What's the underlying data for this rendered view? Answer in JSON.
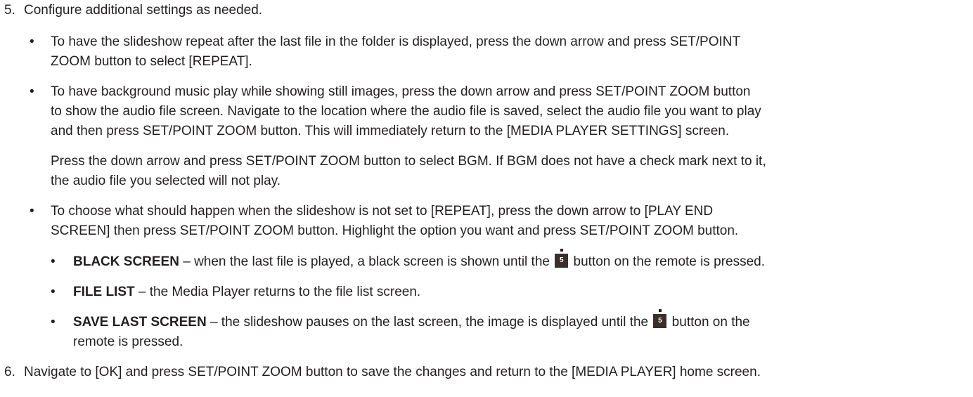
{
  "step5": {
    "number": "5.",
    "text": "Configure additional settings as needed."
  },
  "bullet_repeat": {
    "marker": "•",
    "line1": "To have the slideshow repeat after the last file in the folder is displayed, press the down arrow and press SET/POINT",
    "line2": "ZOOM button to select [REPEAT]."
  },
  "bullet_bgm": {
    "marker": "•",
    "line1": "To have background music play while showing still images, press the down arrow and press SET/POINT ZOOM button",
    "line2": "to show the audio file screen. Navigate to the location where the audio file is saved, select the audio file you want to play",
    "line3": "and then press SET/POINT ZOOM button. This will immediately return to the [MEDIA PLAYER SETTINGS] screen."
  },
  "bgm_note": {
    "line1": "Press the down arrow and press SET/POINT ZOOM button to select BGM. If BGM does not have a check mark next to it,",
    "line2": "the audio file you selected will not play."
  },
  "bullet_play_end": {
    "marker": "•",
    "line1": "To choose what should happen when the slideshow is not set to [REPEAT], press the down arrow to [PLAY END",
    "line2": "SCREEN] then press SET/POINT ZOOM button. Highlight the option you want and press SET/POINT ZOOM button."
  },
  "option_black": {
    "marker": "•",
    "title": "BLACK SCREEN",
    "text_before": " – when the last file is played, a black screen is shown until the ",
    "text_after": " button on the remote is pressed."
  },
  "option_file_list": {
    "marker": "•",
    "title": "FILE LIST",
    "text": " – the Media Player returns to the file list screen."
  },
  "option_save_last": {
    "marker": "•",
    "title": "SAVE LAST SCREEN",
    "text_before": " – the slideshow pauses on the last screen, the image is displayed until the ",
    "text_after": " button on the",
    "line2": "remote is pressed."
  },
  "remote_button": {
    "icon": "remote-5-button-icon",
    "label": "5"
  },
  "step6": {
    "number": "6.",
    "text": "Navigate to [OK] and press SET/POINT ZOOM button to save the changes and return to the [MEDIA PLAYER] home screen."
  }
}
